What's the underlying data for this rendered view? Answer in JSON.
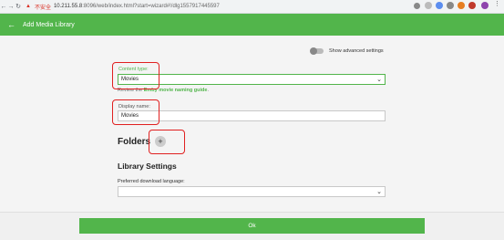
{
  "browser": {
    "security_warning": "不安全",
    "url_host": "10.211.55.8",
    "url_path": ":8096/web/index.html?start=wizard#!/dlg1557917445597",
    "back_icon": "arrow-left-icon",
    "forward_icon": "arrow-right-icon",
    "reload_icon": "reload-icon"
  },
  "appbar": {
    "back_icon": "arrow-left-icon",
    "title": "Add Media Library"
  },
  "advanced": {
    "label": "Show advanced settings"
  },
  "content_type": {
    "label": "Content type:",
    "value": "Movies",
    "hint_prefix": "Review the ",
    "hint_link": "Emby movie naming guide",
    "hint_suffix": "."
  },
  "display_name": {
    "label": "Display name:",
    "value": "Movies"
  },
  "folders": {
    "heading": "Folders",
    "add_label": "+"
  },
  "library_settings": {
    "heading": "Library Settings",
    "download_language_label": "Preferred download language:",
    "download_language_value": ""
  },
  "footer": {
    "ok_label": "Ok"
  },
  "colors": {
    "accent": "#52b54b",
    "annotation": "#e02020"
  }
}
